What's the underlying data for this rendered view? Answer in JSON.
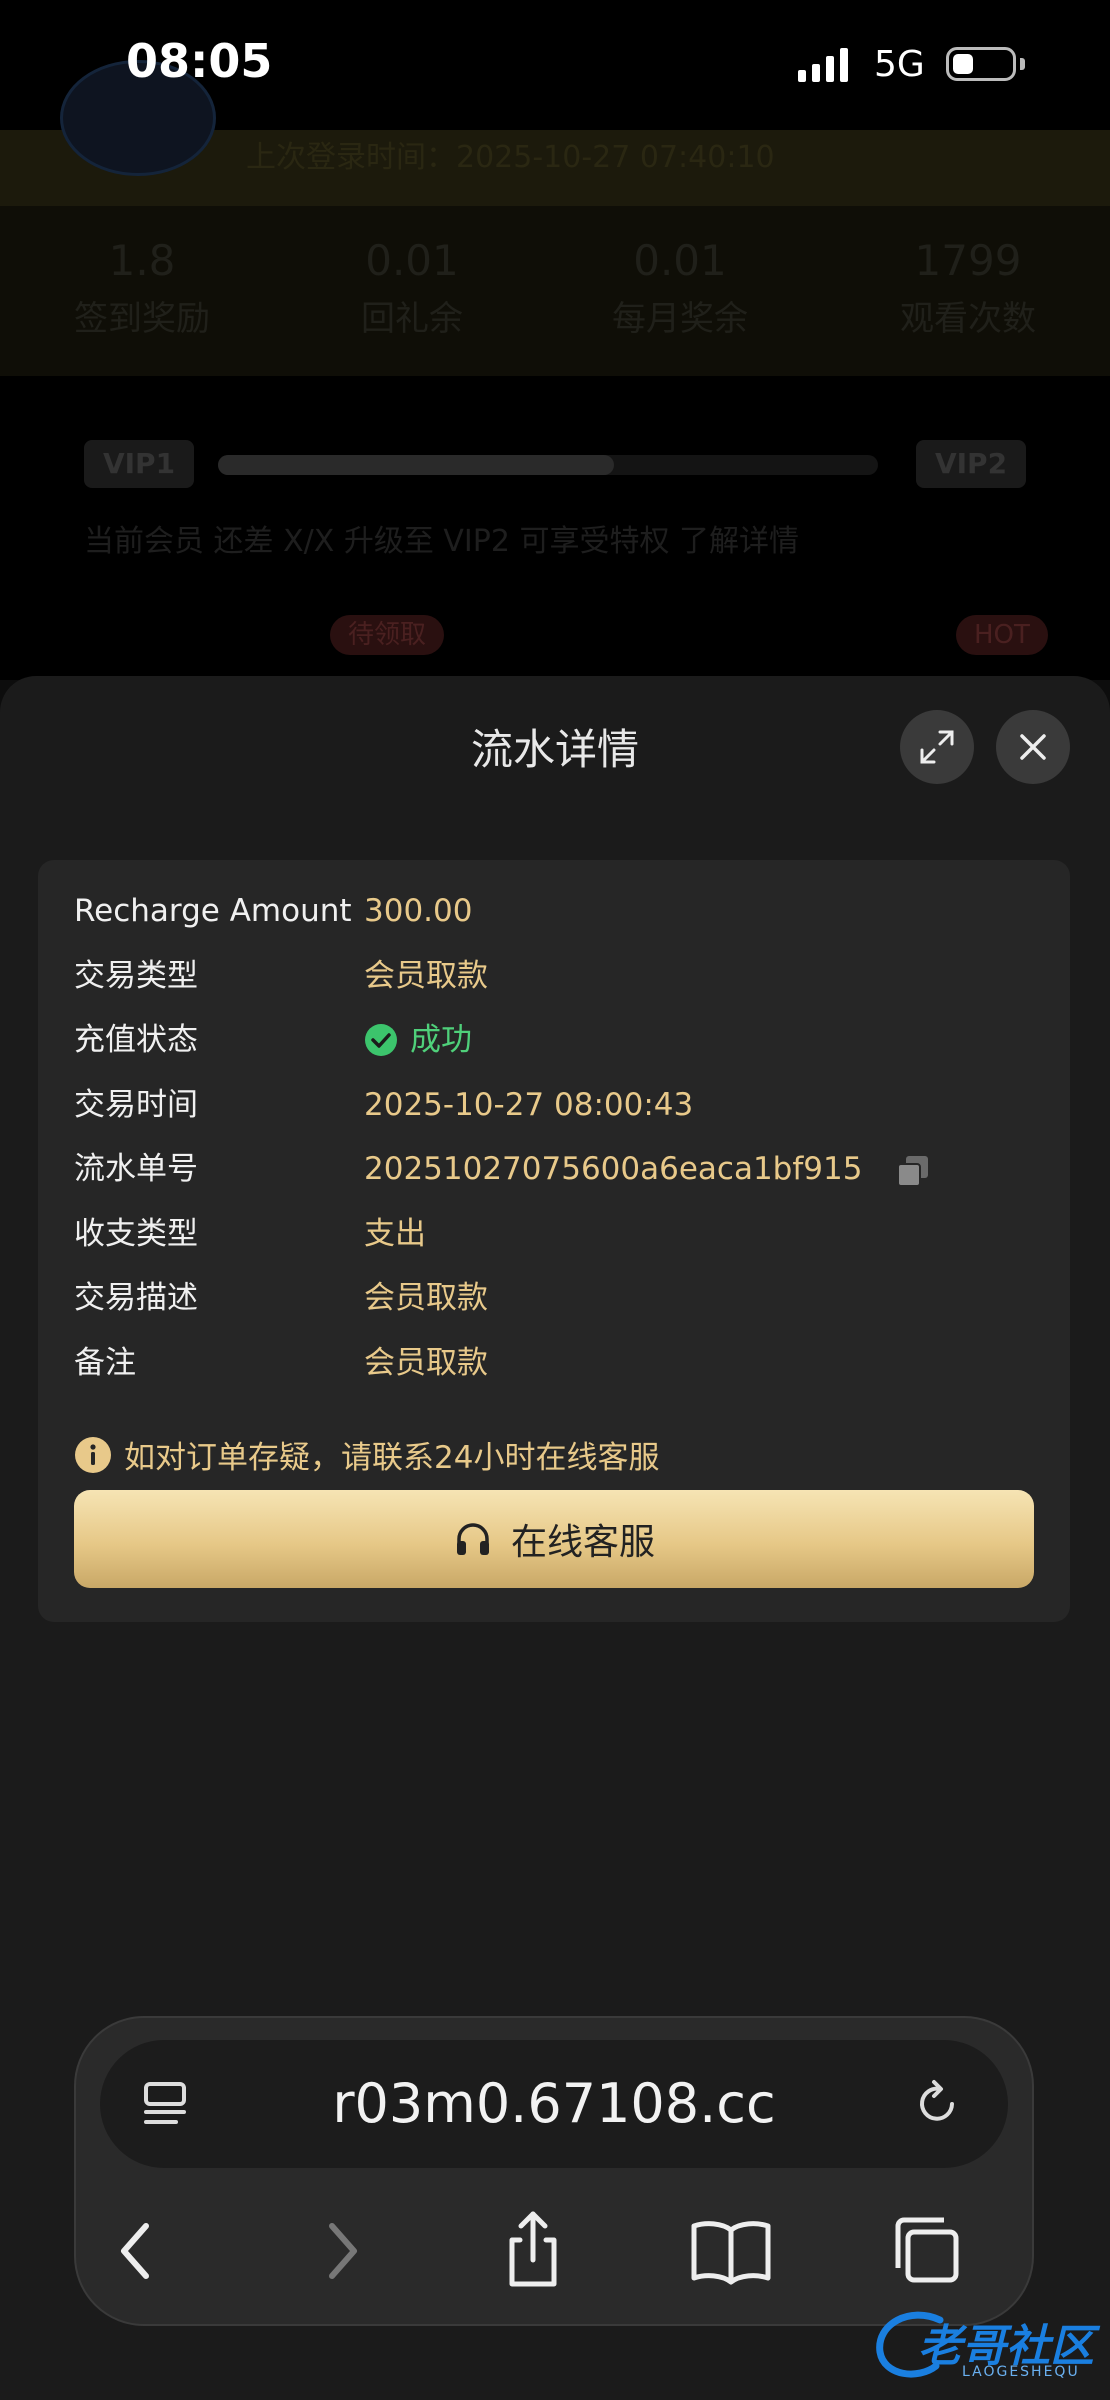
{
  "status_bar": {
    "time": "08:05",
    "network": "5G",
    "battery_level": 0.35
  },
  "background_page": {
    "login_time": "上次登录时间：2025-10-27 07:40:10",
    "stats": [
      {
        "value": "1.8",
        "label": "签到奖励"
      },
      {
        "value": "0.01",
        "label": "回礼余"
      },
      {
        "value": "0.01",
        "label": "每月奖余"
      },
      {
        "value": "1799",
        "label": "观看次数"
      }
    ],
    "vip_current": "VIP1",
    "vip_next": "VIP2",
    "vip_progress": 0.6,
    "vip_description": "当前会员  还差 X/X 升级至 VIP2 可享受特权  了解详情",
    "badges": [
      "待领取",
      "HOT"
    ]
  },
  "sheet": {
    "title": "流水详情",
    "expand_icon": "expand-icon",
    "close_icon": "close-icon",
    "details": [
      {
        "label": "Recharge Amount",
        "value": "300.00"
      },
      {
        "label": "交易类型",
        "value": "会员取款"
      },
      {
        "label": "充值状态",
        "value": "成功"
      },
      {
        "label": "交易时间",
        "value": "2025-10-27 08:00:43"
      },
      {
        "label": "流水单号",
        "value": "20251027075600a6eaca1bf915"
      },
      {
        "label": "收支类型",
        "value": "支出"
      },
      {
        "label": "交易描述",
        "value": "会员取款"
      },
      {
        "label": "备注",
        "value": "会员取款"
      }
    ],
    "notice": "如对订单存疑，请联系24小时在线客服",
    "support_button": "在线客服",
    "colors": {
      "value_gold": "#e8c98a",
      "success_green": "#4fd07a",
      "button_gold": "#e6c887"
    }
  },
  "browser": {
    "url": "r03m0.67108.cc",
    "icons": [
      "tab-menu-icon",
      "reload-icon",
      "back-icon",
      "forward-icon",
      "share-icon",
      "bookmarks-icon",
      "tabs-icon"
    ]
  },
  "watermark": {
    "text": "老哥社区",
    "sub": "LAOGESHEQU"
  }
}
